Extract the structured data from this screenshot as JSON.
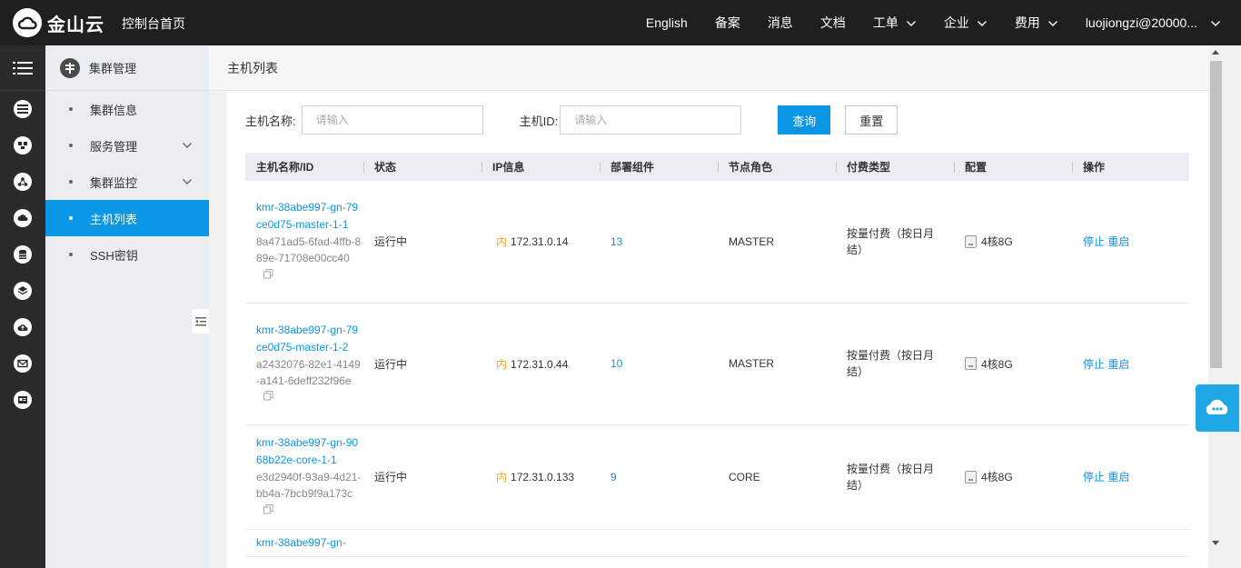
{
  "header": {
    "logo_text": "金山云",
    "console_home": "控制台首页",
    "nav": [
      {
        "label": "English",
        "has_dropdown": false
      },
      {
        "label": "备案",
        "has_dropdown": false
      },
      {
        "label": "消息",
        "has_dropdown": false
      },
      {
        "label": "文档",
        "has_dropdown": false
      },
      {
        "label": "工单",
        "has_dropdown": true
      },
      {
        "label": "企业",
        "has_dropdown": true
      },
      {
        "label": "费用",
        "has_dropdown": true
      }
    ],
    "user": "luojiongzi@20000..."
  },
  "icon_sidebar": [
    "menu-icon",
    "list-icon",
    "dashboard-icon",
    "network-icon",
    "cloud-chat-icon",
    "database-icon",
    "layers-icon",
    "cloud-upload-icon",
    "mail-icon",
    "id-card-icon"
  ],
  "sidebar": {
    "section_title": "集群管理",
    "items": [
      {
        "label": "集群信息",
        "has_dropdown": false,
        "active": false
      },
      {
        "label": "服务管理",
        "has_dropdown": true,
        "active": false
      },
      {
        "label": "集群监控",
        "has_dropdown": true,
        "active": false
      },
      {
        "label": "主机列表",
        "has_dropdown": false,
        "active": true
      },
      {
        "label": "SSH密钥",
        "has_dropdown": false,
        "active": false
      }
    ]
  },
  "page": {
    "title": "主机列表",
    "filters": {
      "host_name_label": "主机名称:",
      "host_name_placeholder": "请输入",
      "host_id_label": "主机ID:",
      "host_id_placeholder": "请输入",
      "search_label": "查询",
      "reset_label": "重置"
    },
    "table": {
      "columns": [
        "主机名称/ID",
        "状态",
        "IP信息",
        "部署组件",
        "节点角色",
        "付费类型",
        "配置",
        "操作"
      ],
      "ip_tag": "内",
      "rows": [
        {
          "name": "kmr-38abe997-gn-79ce0d75-master-1-1",
          "id": "8a471ad5-6fad-4ffb-889e-71708e00cc40",
          "status": "运行中",
          "ip": "172.31.0.14",
          "components": "13",
          "role": "MASTER",
          "billing": "按量付费（按日月结）",
          "config": "4核8G",
          "stop": "停止",
          "restart": "重启"
        },
        {
          "name": "kmr-38abe997-gn-79ce0d75-master-1-2",
          "id": "a2432076-82e1-4149-a141-6deff232f96e",
          "status": "运行中",
          "ip": "172.31.0.44",
          "components": "10",
          "role": "MASTER",
          "billing": "按量付费（按日月结）",
          "config": "4核8G",
          "stop": "停止",
          "restart": "重启"
        },
        {
          "name": "kmr-38abe997-gn-9068b22e-core-1-1",
          "id": "e3d2940f-93a9-4d21-bb4a-7bcb9f9a173c",
          "status": "运行中",
          "ip": "172.31.0.133",
          "components": "9",
          "role": "CORE",
          "billing": "按量付费（按日月结）",
          "config": "4核8G",
          "stop": "停止",
          "restart": "重启"
        },
        {
          "name": "kmr-38abe997-gn-",
          "id": "",
          "status": "",
          "ip": "",
          "components": "",
          "role": "",
          "billing": "",
          "config": "",
          "stop": "",
          "restart": ""
        }
      ]
    }
  },
  "colors": {
    "accent": "#0b96e6",
    "topbar": "#1f1f1f",
    "iconbar": "#2b2b2b",
    "ip_tag": "#f5a623"
  }
}
